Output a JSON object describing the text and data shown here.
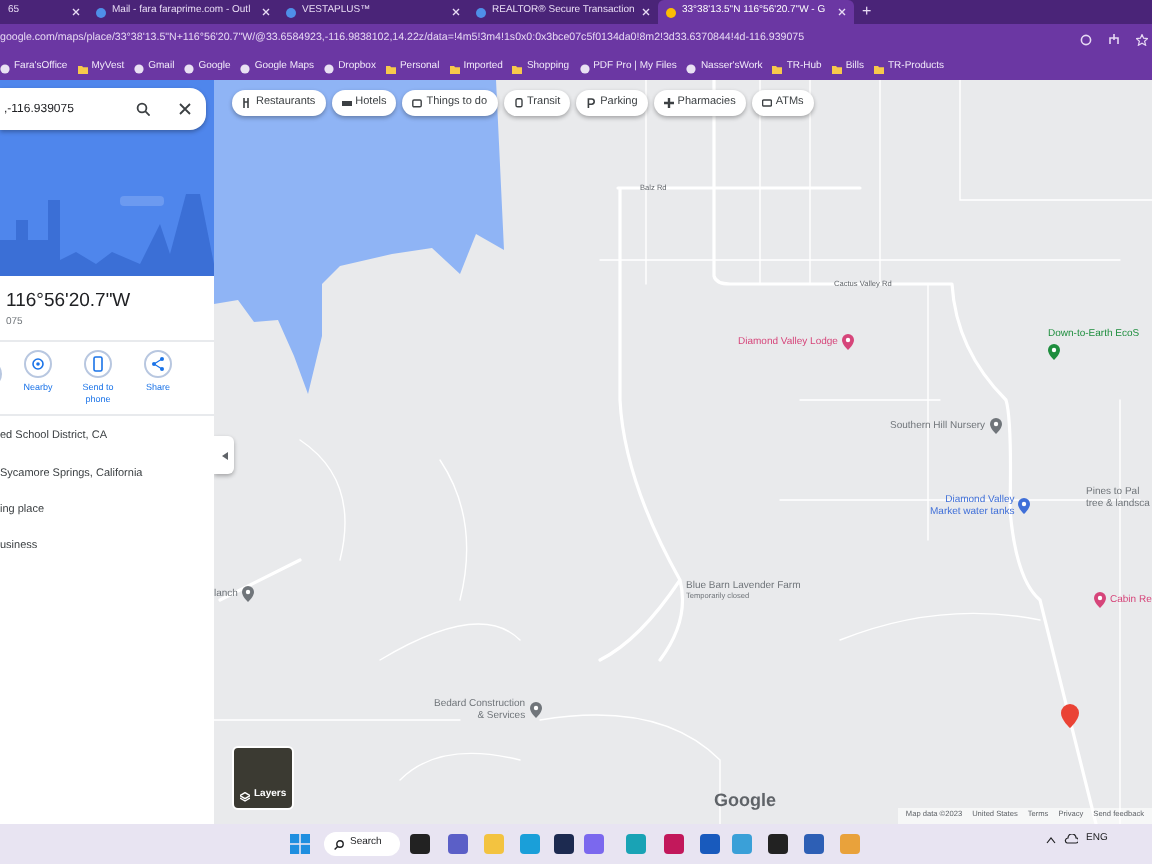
{
  "browser": {
    "tabs": [
      {
        "title": "65",
        "selected": false
      },
      {
        "title": "Mail - fara faraprime.com - Outl",
        "selected": false
      },
      {
        "title": "VESTAPLUS™",
        "selected": false
      },
      {
        "title": "REALTOR® Secure Transaction",
        "selected": false
      },
      {
        "title": "33°38'13.5\"N 116°56'20.7\"W - G",
        "selected": true
      }
    ],
    "new_tab": "+",
    "address": "google.com/maps/place/33°38'13.5\"N+116°56'20.7\"W/@33.6584923,-116.9838102,14.22z/data=!4m5!3m4!1s0x0:0x3bce07c5f0134da0!8m2!3d33.6370844!4d-116.939075",
    "bookmarks": [
      {
        "label": "Fara'sOffice",
        "kind": "site"
      },
      {
        "label": "MyVest",
        "kind": "folder"
      },
      {
        "label": "Gmail",
        "kind": "site"
      },
      {
        "label": "Google",
        "kind": "site"
      },
      {
        "label": "Google Maps",
        "kind": "site"
      },
      {
        "label": "Dropbox",
        "kind": "site"
      },
      {
        "label": "Personal",
        "kind": "folder"
      },
      {
        "label": "Imported",
        "kind": "folder"
      },
      {
        "label": "Shopping",
        "kind": "folder"
      },
      {
        "label": "PDF Pro | My Files",
        "kind": "site"
      },
      {
        "label": "Nasser'sWork",
        "kind": "site"
      },
      {
        "label": "TR-Hub",
        "kind": "folder"
      },
      {
        "label": "Bills",
        "kind": "folder"
      },
      {
        "label": "TR-Products",
        "kind": "folder"
      }
    ]
  },
  "sidebar": {
    "search": {
      "value": ",-116.939075"
    },
    "title": "116°56'20.7\"W",
    "subtitle": "075",
    "actions": [
      {
        "label": "Nearby"
      },
      {
        "label": "Send to phone"
      },
      {
        "label": "Share"
      }
    ],
    "details": [
      "ed School District, CA",
      "Sycamore Springs, California",
      "ing place",
      "usiness"
    ]
  },
  "map": {
    "chips": [
      "Restaurants",
      "Hotels",
      "Things to do",
      "Transit",
      "Parking",
      "Pharmacies",
      "ATMs"
    ],
    "road_labels": [
      "Balz Rd",
      "Cactus Valley Rd"
    ],
    "places": [
      {
        "lines": [
          "Diamond Valley Lodge"
        ],
        "color": "#d6457a"
      },
      {
        "lines": [
          "Down-to-Earth EcoS"
        ],
        "color": "#1e8e3e"
      },
      {
        "lines": [
          "Southern Hill Nursery"
        ],
        "color": "#70757a"
      },
      {
        "lines": [
          "Diamond Valley",
          "Market water tanks"
        ],
        "color": "#3f6fd8"
      },
      {
        "lines": [
          "Pines to Pal",
          "tree & landsca"
        ],
        "color": "#70757a"
      },
      {
        "lines": [
          "Blue Barn Lavender Farm",
          "Temporarily closed"
        ],
        "color": "#70757a"
      },
      {
        "lines": [
          "Cabin Re"
        ],
        "color": "#d6457a"
      },
      {
        "lines": [
          "Bedard Construction",
          "& Services"
        ],
        "color": "#70757a"
      },
      {
        "lines": [
          "lanch"
        ],
        "color": "#70757a"
      }
    ],
    "logo": "Google",
    "layers": "Layers",
    "attribution": [
      "Map data ©2023",
      "United States",
      "Terms",
      "Privacy",
      "Send feedback"
    ]
  },
  "taskbar": {
    "search": "Search",
    "language": "ENG"
  }
}
